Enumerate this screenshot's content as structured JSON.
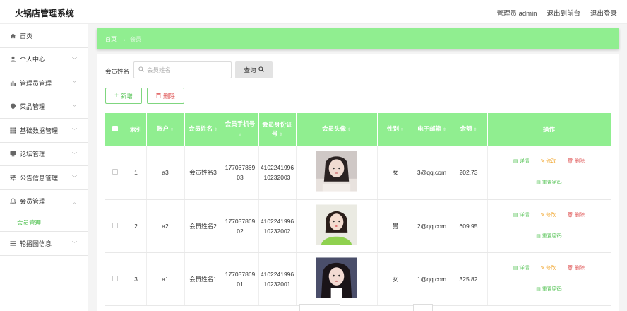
{
  "header": {
    "title": "火锅店管理系统",
    "admin_label": "管理员 admin",
    "to_front": "退出到前台",
    "logout": "退出登录"
  },
  "sidebar": {
    "items": [
      {
        "label": "首页",
        "icon": "home-icon",
        "chevron": ""
      },
      {
        "label": "个人中心",
        "icon": "user-icon",
        "chevron": "﹀"
      },
      {
        "label": "管理员管理",
        "icon": "bar-chart-icon",
        "chevron": "﹀"
      },
      {
        "label": "菜品管理",
        "icon": "pin-icon",
        "chevron": "﹀"
      },
      {
        "label": "基础数据管理",
        "icon": "grid-icon",
        "chevron": "﹀"
      },
      {
        "label": "论坛管理",
        "icon": "monitor-icon",
        "chevron": "﹀"
      },
      {
        "label": "公告信息管理",
        "icon": "sliders-icon",
        "chevron": "﹀"
      },
      {
        "label": "会员管理",
        "icon": "bell-icon",
        "chevron": "︿"
      },
      {
        "label": "轮播图信息",
        "icon": "list-icon",
        "chevron": "﹀"
      }
    ],
    "sub_item": "会员管理"
  },
  "breadcrumb": {
    "home": "首页",
    "arrow": "→",
    "current": "会员"
  },
  "search": {
    "label": "会员姓名",
    "placeholder": "会员姓名",
    "button": "查询"
  },
  "actions": {
    "add": "新增",
    "delete": "删除"
  },
  "table": {
    "columns": [
      "索引",
      "账户",
      "会员姓名",
      "会员手机号",
      "会员身份证号",
      "会员头像",
      "性别",
      "电子邮箱",
      "余额",
      "操作"
    ],
    "rows": [
      {
        "index": "1",
        "account": "a3",
        "name": "会员姓名3",
        "phone": "17703786903",
        "idcard": "410224199610232003",
        "gender": "女",
        "email": "3@qq.com",
        "balance": "202.73"
      },
      {
        "index": "2",
        "account": "a2",
        "name": "会员姓名2",
        "phone": "17703786902",
        "idcard": "410224199610232002",
        "gender": "男",
        "email": "2@qq.com",
        "balance": "609.95"
      },
      {
        "index": "3",
        "account": "a1",
        "name": "会员姓名1",
        "phone": "17703786901",
        "idcard": "410224199610232001",
        "gender": "女",
        "email": "1@qq.com",
        "balance": "325.82"
      }
    ],
    "row_actions": {
      "detail": "详情",
      "edit": "修改",
      "delete": "删除",
      "reset": "重置密码"
    }
  },
  "colors": {
    "accent": "#90ee90",
    "text_green": "#58c458",
    "danger": "#e05a5a",
    "warning": "#f0a020"
  }
}
